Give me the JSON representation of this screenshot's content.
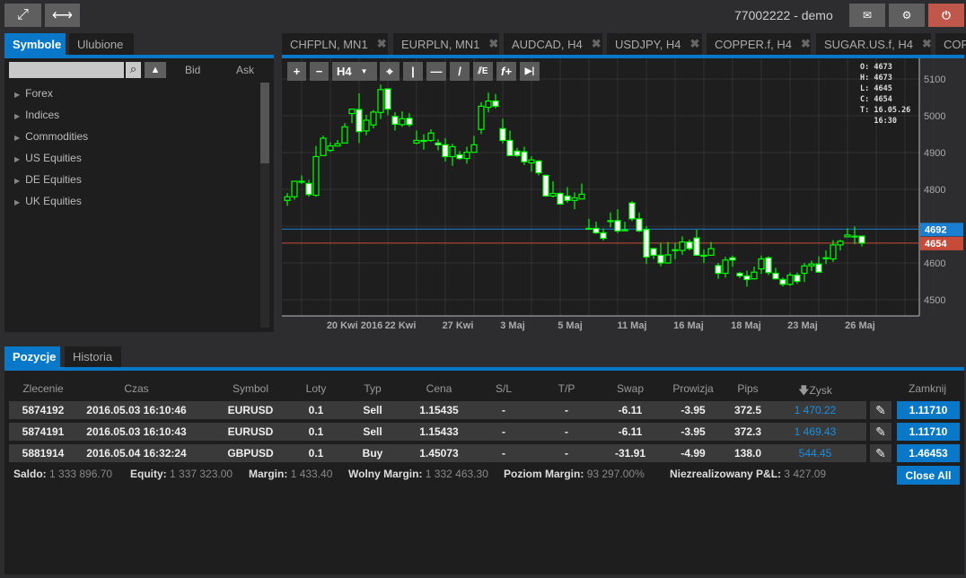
{
  "header": {
    "account": "77002222 - demo",
    "icons": [
      "expand-icon",
      "horizontal-resize-icon",
      "mail-icon",
      "gear-icon",
      "power-icon"
    ]
  },
  "left_panel": {
    "tabs": [
      {
        "label": "Symbole",
        "active": true
      },
      {
        "label": "Ulubione",
        "active": false
      }
    ],
    "search": {
      "value": "",
      "placeholder": ""
    },
    "columns": {
      "bid": "Bid",
      "ask": "Ask"
    },
    "tree": [
      {
        "label": "Forex"
      },
      {
        "label": "Indices"
      },
      {
        "label": "Commodities"
      },
      {
        "label": "US Equities"
      },
      {
        "label": "DE Equities"
      },
      {
        "label": "UK Equities"
      }
    ]
  },
  "chart_tabs": [
    {
      "label": "CHFPLN, MN1"
    },
    {
      "label": "EURPLN, MN1"
    },
    {
      "label": "AUDCAD, H4"
    },
    {
      "label": "USDJPY, H4"
    },
    {
      "label": "COPPER.f, H4"
    },
    {
      "label": "SUGAR.US.f, H4"
    },
    {
      "label": "COF"
    }
  ],
  "toolbar": {
    "timeframe": "H4",
    "tools": [
      "zoom-in",
      "zoom-out",
      "timeframe",
      "crosshair",
      "vertical-line",
      "horizontal-line",
      "trend-line",
      "fibonacci",
      "indicators",
      "scroll-end"
    ]
  },
  "colors": {
    "accent": "#0a78c8",
    "bull": "#00ff00",
    "ask_line": "#1a7fd0",
    "bid_line": "#c84b3a",
    "power": "#c0574b"
  },
  "chart_data": {
    "type": "candlestick",
    "ohlc_readout": {
      "O": "4673",
      "H": "4673",
      "L": "4645",
      "C": "4654",
      "T": "16.05.26",
      "time": "16:30"
    },
    "ask": "4692",
    "bid": "4654",
    "ylim": [
      4450,
      5150
    ],
    "yticks": [
      "5100",
      "5000",
      "4900",
      "4800",
      "4700",
      "4600",
      "4500"
    ],
    "xticks": [
      "20 Kwi 2016",
      "22 Kwi",
      "27 Kwi",
      "3 Maj",
      "5 Maj",
      "11 Maj",
      "16 Maj",
      "18 Maj",
      "23 Maj",
      "26 Maj"
    ],
    "candles": [
      [
        4770,
        4790,
        4755,
        4780
      ],
      [
        4780,
        4822,
        4772,
        4822
      ],
      [
        4822,
        4838,
        4815,
        4822
      ],
      [
        4816,
        4826,
        4780,
        4786
      ],
      [
        4784,
        4918,
        4780,
        4889
      ],
      [
        4892,
        4946,
        4892,
        4939
      ],
      [
        4906,
        4928,
        4902,
        4918
      ],
      [
        4918,
        4934,
        4916,
        4924
      ],
      [
        4926,
        4980,
        4926,
        4970
      ],
      [
        5006,
        5018,
        4980,
        5018
      ],
      [
        5017,
        5061,
        4926,
        4957
      ],
      [
        4959,
        5003,
        4947,
        4988
      ],
      [
        4975,
        5016,
        4966,
        5010
      ],
      [
        5009,
        5085,
        4991,
        5071
      ],
      [
        5073,
        5075,
        5002,
        5018
      ],
      [
        4998,
        5010,
        4960,
        4977
      ],
      [
        4976,
        5012,
        4970,
        4992
      ],
      [
        4993,
        5007,
        4970,
        4976
      ],
      [
        4926,
        4960,
        4922,
        4933
      ],
      [
        4933,
        4950,
        4908,
        4933
      ],
      [
        4933,
        4963,
        4929,
        4953
      ],
      [
        4926,
        4936,
        4906,
        4921
      ],
      [
        4921,
        4939,
        4876,
        4889
      ],
      [
        4889,
        4924,
        4864,
        4916
      ],
      [
        4894,
        4904,
        4880,
        4884
      ],
      [
        4884,
        4916,
        4870,
        4901
      ],
      [
        4901,
        4945,
        4901,
        4921
      ],
      [
        4963,
        5037,
        4950,
        5026
      ],
      [
        5023,
        5063,
        5009,
        5040
      ],
      [
        5040,
        5059,
        5020,
        5026
      ],
      [
        4965,
        4992,
        4925,
        4933
      ],
      [
        4933,
        4960,
        4892,
        4892
      ],
      [
        4904,
        4913,
        4888,
        4892
      ],
      [
        4902,
        4916,
        4866,
        4875
      ],
      [
        4872,
        4890,
        4848,
        4880
      ],
      [
        4877,
        4880,
        4838,
        4845
      ],
      [
        4838,
        4840,
        4780,
        4782
      ],
      [
        4782,
        4822,
        4778,
        4789
      ],
      [
        4789,
        4792,
        4758,
        4760
      ],
      [
        4782,
        4806,
        4764,
        4770
      ],
      [
        4770,
        4792,
        4746,
        4777
      ],
      [
        4774,
        4816,
        4773,
        4787
      ],
      [
        4694,
        4720,
        4690,
        4694
      ],
      [
        4694,
        4712,
        4679,
        4682
      ],
      [
        4682,
        4694,
        4661,
        4667
      ],
      [
        4715,
        4737,
        4697,
        4715
      ],
      [
        4715,
        4746,
        4681,
        4687
      ],
      [
        4690,
        4712,
        4686,
        4690
      ],
      [
        4763,
        4768,
        4714,
        4720
      ],
      [
        4720,
        4737,
        4684,
        4687
      ],
      [
        4691,
        4700,
        4597,
        4616
      ],
      [
        4639,
        4641,
        4611,
        4621
      ],
      [
        4621,
        4655,
        4591,
        4600
      ],
      [
        4600,
        4657,
        4598,
        4622
      ],
      [
        4636,
        4655,
        4610,
        4636
      ],
      [
        4634,
        4672,
        4622,
        4657
      ],
      [
        4657,
        4664,
        4634,
        4639
      ],
      [
        4668,
        4690,
        4621,
        4621
      ],
      [
        4621,
        4637,
        4600,
        4621
      ],
      [
        4621,
        4657,
        4620,
        4639
      ],
      [
        4593,
        4600,
        4557,
        4572
      ],
      [
        4572,
        4617,
        4560,
        4608
      ],
      [
        4614,
        4620,
        4590,
        4608
      ],
      [
        4572,
        4576,
        4559,
        4565
      ],
      [
        4565,
        4579,
        4536,
        4555
      ],
      [
        4557,
        4590,
        4555,
        4575
      ],
      [
        4584,
        4620,
        4570,
        4611
      ],
      [
        4614,
        4618,
        4567,
        4574
      ],
      [
        4572,
        4587,
        4555,
        4557
      ],
      [
        4555,
        4560,
        4536,
        4542
      ],
      [
        4542,
        4574,
        4538,
        4567
      ],
      [
        4567,
        4574,
        4543,
        4550
      ],
      [
        4572,
        4600,
        4548,
        4592
      ],
      [
        4592,
        4606,
        4578,
        4597
      ],
      [
        4597,
        4618,
        4575,
        4575
      ],
      [
        4614,
        4634,
        4597,
        4614
      ],
      [
        4611,
        4662,
        4603,
        4649
      ],
      [
        4649,
        4663,
        4634,
        4659
      ],
      [
        4671,
        4694,
        4671,
        4676
      ],
      [
        4673,
        4699,
        4651,
        4673
      ],
      [
        4673,
        4673,
        4645,
        4654
      ]
    ]
  },
  "bottom_panel": {
    "tabs": [
      {
        "label": "Pozycje",
        "active": true
      },
      {
        "label": "Historia",
        "active": false
      }
    ],
    "columns": [
      "Zlecenie",
      "Czas",
      "Symbol",
      "Loty",
      "Typ",
      "Cena",
      "S/L",
      "T/P",
      "Swap",
      "Prowizja",
      "Pips",
      "Zysk",
      "Zamknij"
    ],
    "rows": [
      {
        "order": "5874192",
        "time": "2016.05.03 16:10:46",
        "symbol": "EURUSD",
        "lots": "0.1",
        "type": "Sell",
        "price": "1.15435",
        "sl": "-",
        "tp": "-",
        "swap": "-6.11",
        "commission": "-3.95",
        "pips": "372.5",
        "profit": "1 470.22",
        "close": "1.11710"
      },
      {
        "order": "5874191",
        "time": "2016.05.03 16:10:43",
        "symbol": "EURUSD",
        "lots": "0.1",
        "type": "Sell",
        "price": "1.15433",
        "sl": "-",
        "tp": "-",
        "swap": "-6.11",
        "commission": "-3.95",
        "pips": "372.3",
        "profit": "1 469.43",
        "close": "1.11710"
      },
      {
        "order": "5881914",
        "time": "2016.05.04 16:32:24",
        "symbol": "GBPUSD",
        "lots": "0.1",
        "type": "Buy",
        "price": "1.45073",
        "sl": "-",
        "tp": "-",
        "swap": "-31.91",
        "commission": "-4.99",
        "pips": "138.0",
        "profit": "544.45",
        "close": "1.46453"
      }
    ],
    "summary": {
      "saldo_label": "Saldo:",
      "saldo": "1 333 896.70",
      "equity_label": "Equity:",
      "equity": "1 337 323.00",
      "margin_label": "Margin:",
      "margin": "1 433.40",
      "free_label": "Wolny Margin:",
      "free": "1 332 463.30",
      "level_label": "Poziom Margin:",
      "level": "93 297.00%",
      "pnl_label": "Niezrealizowany P&L:",
      "pnl": "3 427.09"
    },
    "close_all": "Close All"
  }
}
